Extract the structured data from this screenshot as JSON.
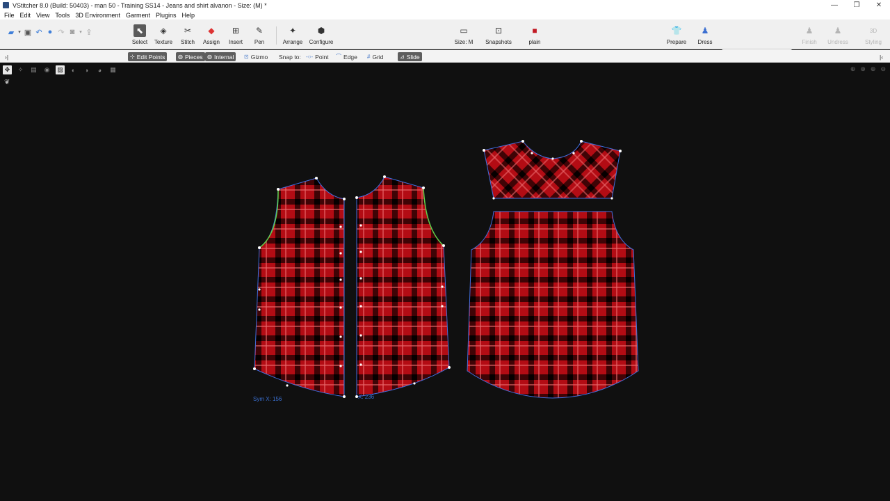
{
  "window": {
    "title": "VStitcher 8.0 (Build: 50403) - man 50 - Training SS14 - Jeans and shirt alvanon - Size: (M) *",
    "controls": [
      "—",
      "❐",
      "✕"
    ]
  },
  "menu": [
    "File",
    "Edit",
    "View",
    "Tools",
    "3D Environment",
    "Garment",
    "Plugins",
    "Help"
  ],
  "toolbar": {
    "tools": [
      {
        "label": "Select",
        "icon": "cursor-icon",
        "glyph": "⬉",
        "active": true
      },
      {
        "label": "Texture",
        "icon": "texture-icon",
        "glyph": "◈"
      },
      {
        "label": "Stitch",
        "icon": "stitch-icon",
        "glyph": "✂"
      },
      {
        "label": "Assign",
        "icon": "assign-icon",
        "glyph": "◆"
      },
      {
        "label": "Insert",
        "icon": "insert-icon",
        "glyph": "⊞"
      },
      {
        "label": "Pen",
        "icon": "pen-icon",
        "glyph": "✎"
      },
      {
        "label": "Arrange",
        "icon": "arrange-icon",
        "glyph": "✦"
      },
      {
        "label": "Configure",
        "icon": "configure-icon",
        "glyph": "⬢"
      }
    ],
    "size": "Size: M",
    "snapshots": "Snapshots",
    "fabric": "plain",
    "prepare": "Prepare",
    "dress": "Dress",
    "finish": "Finish",
    "undress": "Undress",
    "styling": "Styling"
  },
  "subbar": {
    "edit_points": "Edit Points",
    "pieces": "Pieces",
    "internal": "Internal",
    "gizmo": "Gizmo",
    "snap_to": "Snap to:",
    "point": "Point",
    "edge": "Edge",
    "grid": "Grid",
    "slide": "Slide"
  },
  "canvas": {
    "sym_label_left": "Sym X: 156",
    "sym_label_right": "X: 236",
    "colors": {
      "fabric": "#b30c14",
      "outline": "#3f6fe0",
      "curve": "#5fd14a",
      "point": "#ffffff"
    }
  }
}
